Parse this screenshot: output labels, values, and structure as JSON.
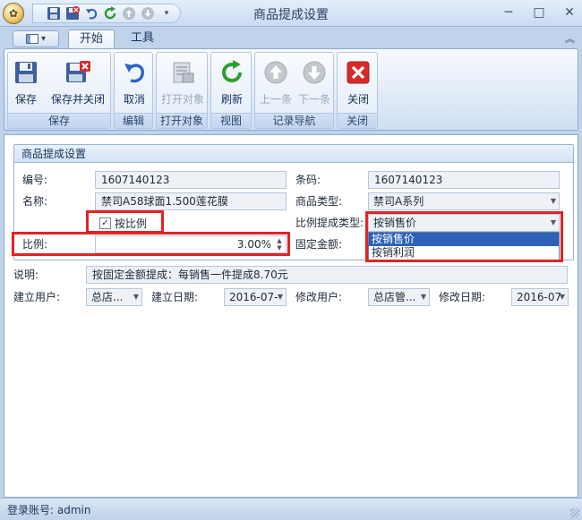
{
  "window": {
    "title": "商品提成设置",
    "minimize": "─",
    "maximize": "□",
    "close": "✕"
  },
  "ribbon": {
    "tabs": [
      {
        "label": "开始",
        "active": true
      },
      {
        "label": "工具",
        "active": false
      }
    ],
    "groups": [
      {
        "label": "保存",
        "buttons": [
          {
            "label": "保存",
            "icon": "save-icon"
          },
          {
            "label": "保存并关闭",
            "icon": "save-close-icon"
          }
        ]
      },
      {
        "label": "编辑",
        "buttons": [
          {
            "label": "取消",
            "icon": "undo-icon"
          }
        ]
      },
      {
        "label": "打开对象",
        "buttons": [
          {
            "label": "打开对象",
            "icon": "open-object-icon",
            "disabled": true
          }
        ]
      },
      {
        "label": "视图",
        "buttons": [
          {
            "label": "刷新",
            "icon": "refresh-icon"
          }
        ]
      },
      {
        "label": "记录导航",
        "buttons": [
          {
            "label": "上一条",
            "icon": "arrow-up-icon",
            "disabled": true
          },
          {
            "label": "下一条",
            "icon": "arrow-down-icon",
            "disabled": true
          }
        ]
      },
      {
        "label": "关闭",
        "buttons": [
          {
            "label": "关闭",
            "icon": "close-icon"
          }
        ]
      }
    ]
  },
  "form": {
    "section_title": "商品提成设置",
    "code_label": "编号:",
    "code_value": "1607140123",
    "barcode_label": "条码:",
    "barcode_value": "1607140123",
    "name_label": "名称:",
    "name_value": "禁司A58球面1.500莲花膜",
    "type_label": "商品类型:",
    "type_value": "禁司A系列",
    "by_ratio_label": "按比例",
    "by_ratio_checked": true,
    "ratio_type_label": "比例提成类型:",
    "ratio_type_value": "按销售价",
    "ratio_type_options": [
      "按销售价",
      "按销利润"
    ],
    "ratio_label": "比例:",
    "ratio_value": "3.00%",
    "fixed_label": "固定金额:",
    "note_label": "说明:",
    "note_value": "按固定金额提成：每销售一件提成8.70元",
    "creator_label": "建立用户:",
    "creator_value": "总店...",
    "create_date_label": "建立日期:",
    "create_date_value": "2016-07-",
    "modifier_label": "修改用户:",
    "modifier_value": "总店管...",
    "modify_date_label": "修改日期:",
    "modify_date_value": "2016-07"
  },
  "status": {
    "login": "登录账号: admin"
  },
  "colors": {
    "highlight_border": "#e02424",
    "selected_option": "#2d62b8"
  }
}
